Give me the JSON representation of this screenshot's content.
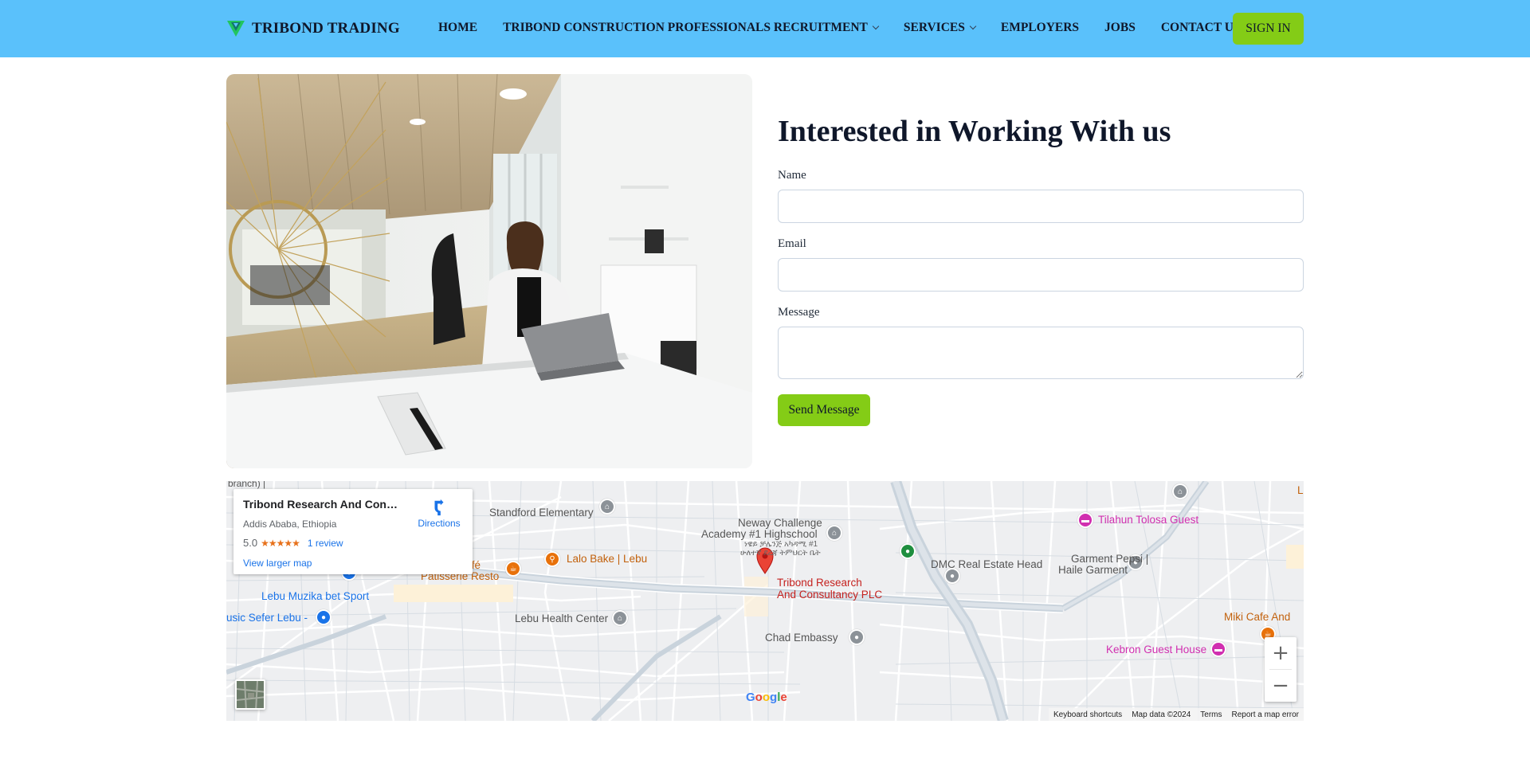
{
  "brand": {
    "name": "TRIBOND TRADING",
    "logo_icon": "v-shield-logo-icon"
  },
  "nav": {
    "items": [
      {
        "label": "HOME",
        "dropdown": false
      },
      {
        "label": "TRIBOND CONSTRUCTION PROFESSIONALS RECRUITMENT",
        "dropdown": true
      },
      {
        "label": "SERVICES",
        "dropdown": true
      },
      {
        "label": "EMPLOYERS",
        "dropdown": false
      },
      {
        "label": "JOBS",
        "dropdown": false
      },
      {
        "label": "CONTACT US",
        "dropdown": false
      }
    ],
    "signin_label": "SIGN IN"
  },
  "contact_form": {
    "title": "Interested in Working With us",
    "name_label": "Name",
    "name_value": "",
    "email_label": "Email",
    "email_value": "",
    "message_label": "Message",
    "message_value": "",
    "submit_label": "Send Message"
  },
  "map": {
    "info_card": {
      "title": "Tribond Research And Consult...",
      "address": "Addis Ababa, Ethiopia",
      "rating": "5.0",
      "stars": "★★★★★",
      "reviews": "1 review",
      "larger_map": "View larger map",
      "directions": "Directions"
    },
    "places": {
      "standford": "Standford Elementary",
      "neway_1": "Neway Challenge",
      "neway_2": "Academy #1 Highschool",
      "neway_amh_1": "ነዌይ ቻሌንጅ አካዳሚ #1",
      "neway_amh_2": "ሁለተኛ ደረጃ ትምህርት ቤት",
      "tilahun": "Tilahun Tolosa Guest",
      "dmc": "DMC Real Estate Head",
      "garment_1": "Garment Pepsi |",
      "garment_2": "Haile Garment",
      "cafe_1": "s Café",
      "cafe_2": "Patisserie Resto",
      "lalo": "Lalo Bake | Lebu",
      "lebu_muzika": "Lebu Muzika bet Sport",
      "music_sefer": "usic Sefer Lebu -",
      "lebu_health": "Lebu Health Center",
      "tribond_1": "Tribond Research",
      "tribond_2": "And Consultancy PLC",
      "chad": "Chad Embassy",
      "miki": "Miki Cafe And",
      "kebron": "Kebron Guest House",
      "branch": "branch) |",
      "edge_l": "L"
    },
    "zoom_in": "+",
    "zoom_out": "−",
    "google": "Google",
    "attribution": {
      "shortcuts": "Keyboard shortcuts",
      "data": "Map data ©2024",
      "terms": "Terms",
      "report": "Report a map error"
    }
  }
}
